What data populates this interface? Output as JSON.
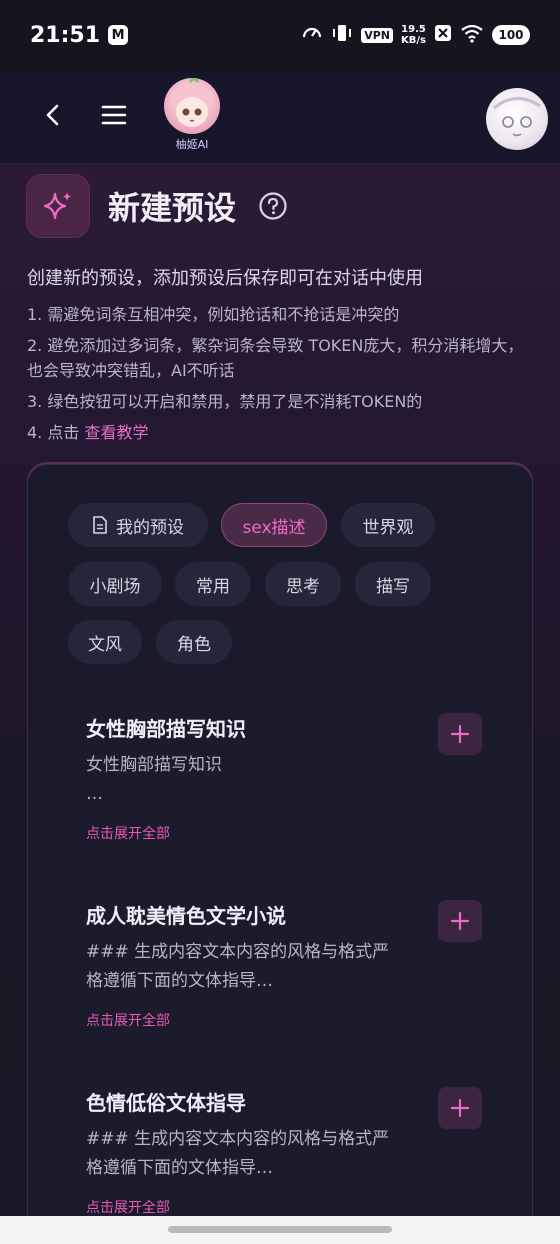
{
  "status_bar": {
    "time": "21:51",
    "notif_letter": "M",
    "vpn": "VPN",
    "speed_value": "19.5",
    "speed_unit": "KB/s",
    "battery": "100",
    "icons": [
      "speedometer-icon",
      "vibrate-icon",
      "vpn-icon",
      "close-box-icon",
      "wifi-icon",
      "battery-icon"
    ]
  },
  "app_bar": {
    "logo_label": "柚姬AI",
    "icons": [
      "back-icon",
      "menu-icon",
      "logo-image",
      "user-avatar"
    ]
  },
  "page": {
    "title": "新建预设",
    "title_icon": "sparkle-icon",
    "help_icon": "question-circle-icon",
    "description": "创建新的预设，添加预设后保存即可在对话中使用",
    "rules": [
      "1. 需避免词条互相冲突，例如抢话和不抢话是冲突的",
      "2. 避免添加过多词条，繁杂词条会导致 TOKEN庞大，积分消耗增大，也会导致冲突错乱，AI不听话",
      "3. 绿色按钮可以开启和禁用，禁用了是不消耗TOKEN的"
    ],
    "rule4_prefix": "4. 点击 ",
    "rule4_link": "查看教学"
  },
  "categories": {
    "active": "sex描述",
    "items": [
      "我的预设",
      "sex描述",
      "世界观",
      "小剧场",
      "常用",
      "思考",
      "描写",
      "文风",
      "角色"
    ]
  },
  "cards": [
    {
      "title": "女性胸部描写知识",
      "body_line1": "女性胸部描写知识",
      "body_line2": "…",
      "expand": "点击展开全部"
    },
    {
      "title": "成人耽美情色文学小说",
      "body_line1": "### 生成内容文本内容的风格与格式严",
      "body_line2": "格遵循下面的文体指导…",
      "expand": "点击展开全部"
    },
    {
      "title": "色情低俗文体指导",
      "body_line1": "### 生成内容文本内容的风格与格式严",
      "body_line2": "格遵循下面的文体指导…",
      "expand": "点击展开全部"
    }
  ],
  "colors": {
    "accent": "#e65ab4",
    "background": "#1b1828",
    "chip": "#242639",
    "chip_active": "#4a2b47"
  }
}
